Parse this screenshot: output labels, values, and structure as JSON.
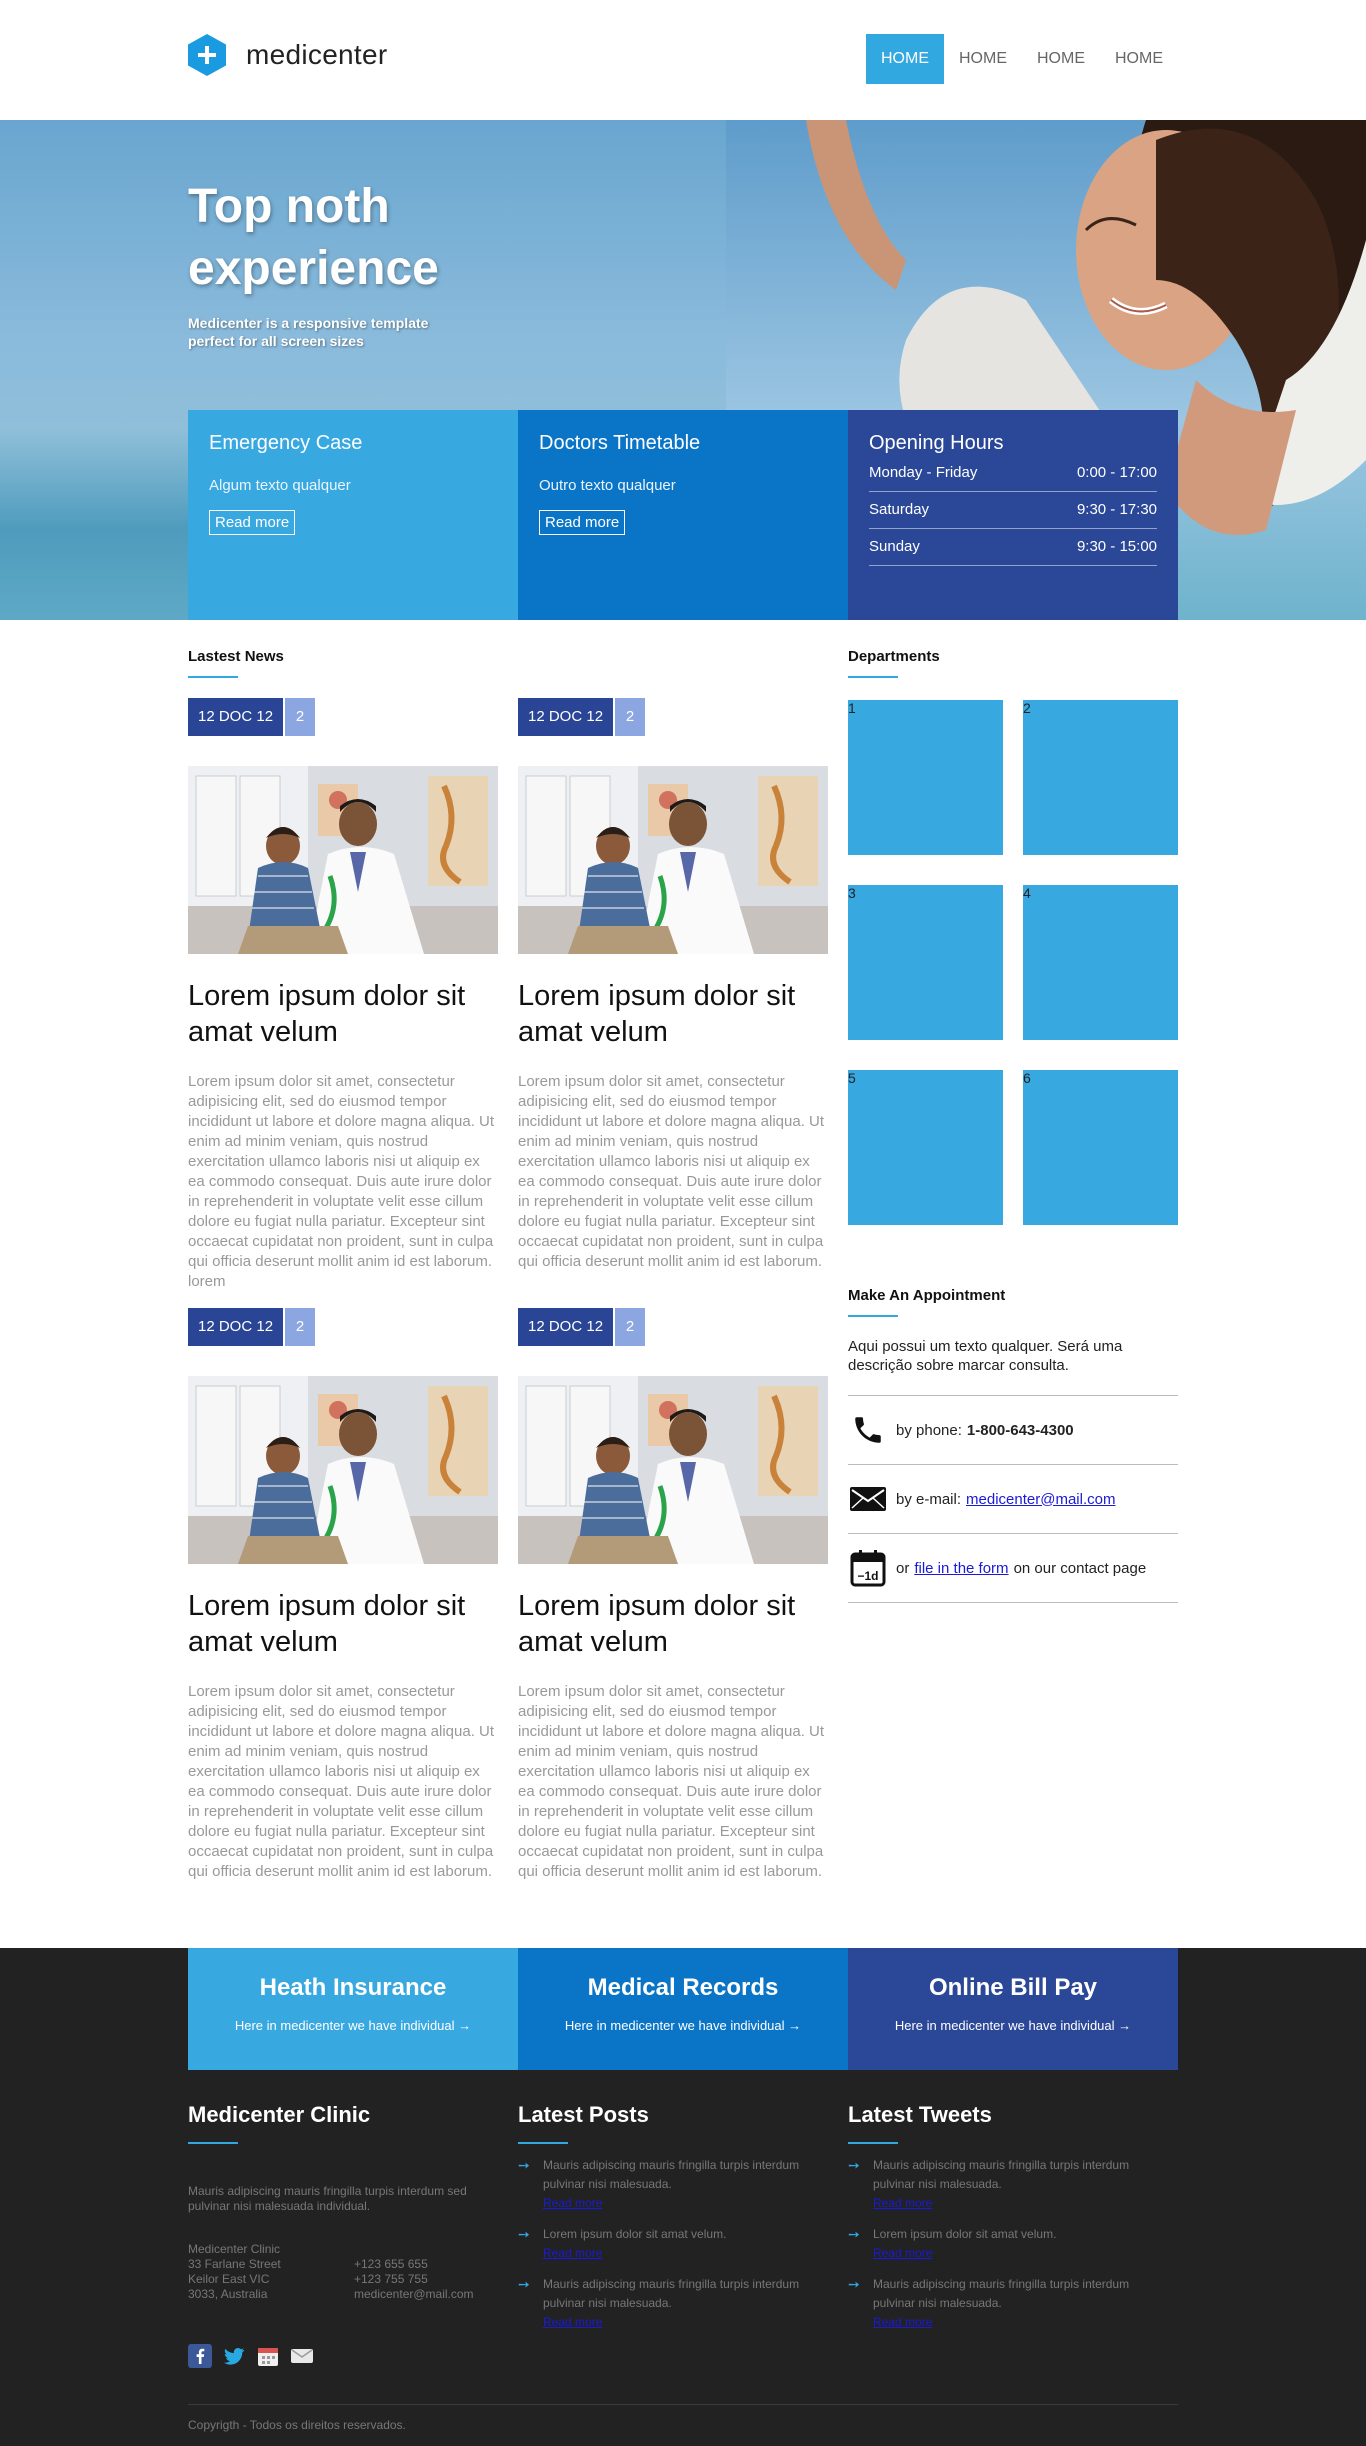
{
  "brand": {
    "name": "medicenter",
    "accent": "#32a8e1"
  },
  "nav": {
    "items": [
      "HOME",
      "HOME",
      "HOME",
      "HOME"
    ],
    "active_index": 0
  },
  "hero": {
    "title": "Top noth experience",
    "subtitle": "Medicenter is a responsive template perfect for all screen sizes"
  },
  "info_boxes": [
    {
      "title": "Emergency Case",
      "text": "Algum texto qualquer",
      "button": "Read more",
      "color": "#38a8e1"
    },
    {
      "title": "Doctors Timetable",
      "text": "Outro texto qualquer",
      "button": "Read more",
      "color": "#0a75c7"
    }
  ],
  "opening_hours": {
    "title": "Opening Hours",
    "color": "#2b4797",
    "rows": [
      {
        "day": "Monday - Friday",
        "time": "0:00 - 17:00"
      },
      {
        "day": "Saturday",
        "time": "9:30 - 17:30"
      },
      {
        "day": "Sunday",
        "time": "9:30 - 15:00"
      }
    ]
  },
  "news": {
    "title": "Lastest News",
    "items": [
      {
        "date": "12 DOC 12",
        "count": "2",
        "title": "Lorem ipsum dolor sit amat velum",
        "body": "Lorem ipsum dolor sit amet, consectetur adipisicing elit, sed do eiusmod tempor incididunt ut labore et dolore magna aliqua. Ut enim ad minim veniam, quis nostrud exercitation ullamco laboris nisi ut aliquip ex ea commodo consequat. Duis aute irure dolor in reprehenderit in voluptate velit esse cillum dolore eu fugiat nulla pariatur. Excepteur sint occaecat cupidatat non proident, sunt in culpa qui officia deserunt mollit anim id est laborum. lorem"
      },
      {
        "date": "12 DOC 12",
        "count": "2",
        "title": "Lorem ipsum dolor sit amat velum",
        "body": "Lorem ipsum dolor sit amet, consectetur adipisicing elit, sed do eiusmod tempor incididunt ut labore et dolore magna aliqua. Ut enim ad minim veniam, quis nostrud exercitation ullamco laboris nisi ut aliquip ex ea commodo consequat. Duis aute irure dolor in reprehenderit in voluptate velit esse cillum dolore eu fugiat nulla pariatur. Excepteur sint occaecat cupidatat non proident, sunt in culpa qui officia deserunt mollit anim id est laborum."
      },
      {
        "date": "12 DOC 12",
        "count": "2",
        "title": "Lorem ipsum dolor sit amat velum",
        "body": "Lorem ipsum dolor sit amet, consectetur adipisicing elit, sed do eiusmod tempor incididunt ut labore et dolore magna aliqua. Ut enim ad minim veniam, quis nostrud exercitation ullamco laboris nisi ut aliquip ex ea commodo consequat. Duis aute irure dolor in reprehenderit in voluptate velit esse cillum dolore eu fugiat nulla pariatur. Excepteur sint occaecat cupidatat non proident, sunt in culpa qui officia deserunt mollit anim id est laborum."
      },
      {
        "date": "12 DOC 12",
        "count": "2",
        "title": "Lorem ipsum dolor sit amat velum",
        "body": "Lorem ipsum dolor sit amet, consectetur adipisicing elit, sed do eiusmod tempor incididunt ut labore et dolore magna aliqua. Ut enim ad minim veniam, quis nostrud exercitation ullamco laboris nisi ut aliquip ex ea commodo consequat. Duis aute irure dolor in reprehenderit in voluptate velit esse cillum dolore eu fugiat nulla pariatur. Excepteur sint occaecat cupidatat non proident, sunt in culpa qui officia deserunt mollit anim id est laborum."
      }
    ]
  },
  "departments": {
    "title": "Departments",
    "items": [
      "1",
      "2",
      "3",
      "4",
      "5",
      "6"
    ]
  },
  "appointment": {
    "title": "Make An Appointment",
    "description": "Aqui possui um texto qualquer. Será uma descrição sobre marcar consulta.",
    "phone_label": "by phone:",
    "phone": "1-800-643-4300",
    "email_label": "by e-mail:",
    "email": "medicenter@mail.com",
    "form_prefix": "or",
    "form_link": "file in the form",
    "form_suffix": "on our contact page"
  },
  "cta": [
    {
      "title": "Heath Insurance",
      "text": "Here in medicenter we have individual",
      "color": "#38a8e1"
    },
    {
      "title": "Medical Records",
      "text": "Here in medicenter we have individual",
      "color": "#0a75c7"
    },
    {
      "title": "Online Bill Pay",
      "text": "Here in medicenter we have individual",
      "color": "#2b4797"
    }
  ],
  "footer": {
    "clinic": {
      "title": "Medicenter Clinic",
      "description": "Mauris adipiscing mauris fringilla turpis interdum sed pulvinar nisi malesuada individual.",
      "address_lines": [
        "Medicenter Clinic",
        "33 Farlane Street",
        "Keilor East VIC",
        "3033, Australia"
      ],
      "contact_lines": [
        "+123 655 655",
        "+123 755 755",
        "medicenter@mail.com"
      ],
      "social_icons": [
        "facebook-icon",
        "twitter-icon",
        "calendar-icon",
        "mail-icon"
      ]
    },
    "posts": {
      "title": "Latest Posts",
      "items": [
        {
          "text": "Mauris adipiscing mauris fringilla turpis interdum pulvinar nisi malesuada.",
          "link": "Read more"
        },
        {
          "text": "Lorem ipsum dolor sit amat velum.",
          "link": "Read more"
        },
        {
          "text": "Mauris adipiscing mauris fringilla turpis interdum pulvinar nisi malesuada.",
          "link": "Read more"
        }
      ]
    },
    "tweets": {
      "title": "Latest Tweets",
      "items": [
        {
          "text": "Mauris adipiscing mauris fringilla turpis interdum pulvinar nisi malesuada.",
          "link": "Read more"
        },
        {
          "text": "Lorem ipsum dolor sit amat velum.",
          "link": "Read more"
        },
        {
          "text": "Mauris adipiscing mauris fringilla turpis interdum pulvinar nisi malesuada.",
          "link": "Read more"
        }
      ]
    },
    "copyright": "Copyrigth - Todos os direitos reservados."
  }
}
